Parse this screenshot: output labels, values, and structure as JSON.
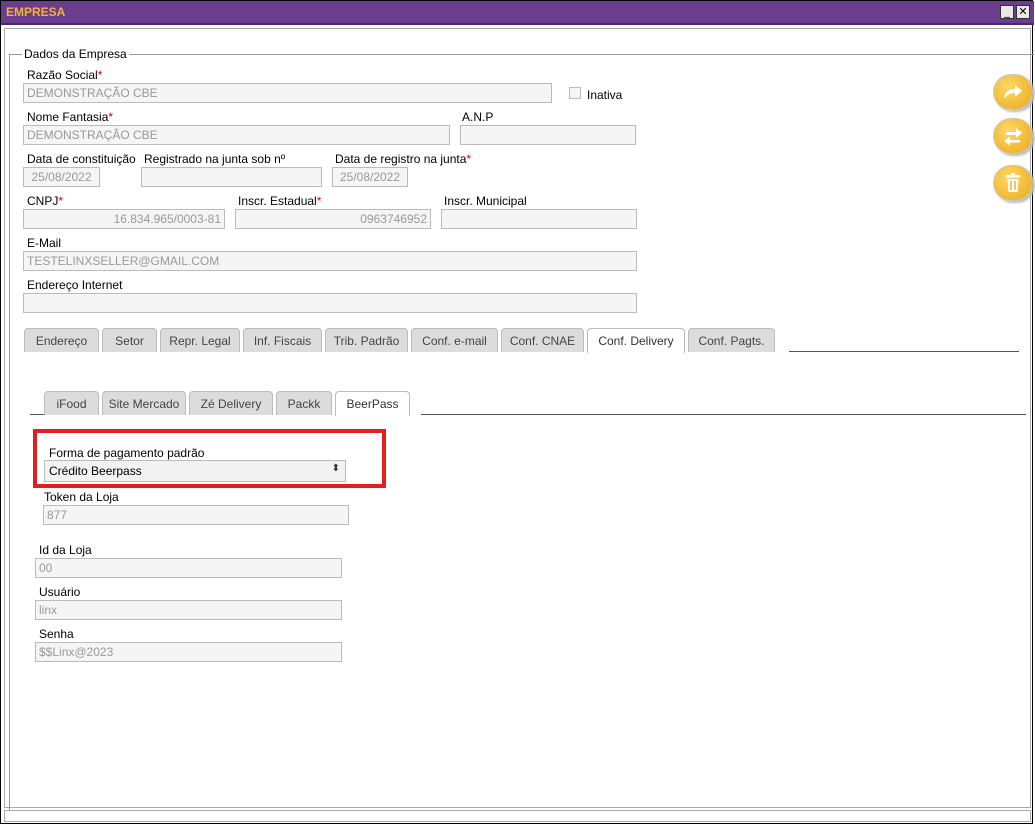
{
  "window": {
    "title": "EMPRESA",
    "minimize_label": "_",
    "close_label": "✕"
  },
  "section": {
    "legend": "Dados da Empresa"
  },
  "fields": {
    "razao_social": {
      "label": "Razão Social",
      "value": "DEMONSTRAÇÃO CBE"
    },
    "inativa": {
      "label": "Inativa"
    },
    "nome_fantasia": {
      "label": "Nome Fantasia",
      "value": "DEMONSTRAÇÃO CBE"
    },
    "anp": {
      "label": "A.N.P",
      "value": ""
    },
    "data_constituicao": {
      "label": "Data de constituição",
      "value": "25/08/2022"
    },
    "registrado_junta": {
      "label": "Registrado na junta sob nº",
      "value": ""
    },
    "data_registro_junta": {
      "label": "Data de registro na junta",
      "value": "25/08/2022"
    },
    "cnpj": {
      "label": "CNPJ",
      "value": "16.834.965/0003-81"
    },
    "inscr_estadual": {
      "label": "Inscr. Estadual",
      "value": "0963746952"
    },
    "inscr_municipal": {
      "label": "Inscr. Municipal",
      "value": ""
    },
    "email": {
      "label": "E-Mail",
      "value": "TESTELINXSELLER@GMAIL.COM"
    },
    "endereco_internet": {
      "label": "Endereço Internet",
      "value": ""
    },
    "required_mark": "*"
  },
  "main_tabs": [
    "Endereço",
    "Setor",
    "Repr. Legal",
    "Inf. Fiscais",
    "Trib. Padrão",
    "Conf. e-mail",
    "Conf. CNAE",
    "Conf. Delivery",
    "Conf. Pagts."
  ],
  "delivery_tabs": [
    "iFood",
    "Site Mercado",
    "Zé Delivery",
    "Packk",
    "BeerPass"
  ],
  "beerpass": {
    "forma_pagamento": {
      "label": "Forma de pagamento padrão",
      "value": "Crédito Beerpass"
    },
    "token": {
      "label": "Token da Loja",
      "value": "877"
    },
    "id_loja": {
      "label": "Id da Loja",
      "value": "00"
    },
    "usuario": {
      "label": "Usuário",
      "value": "linx"
    },
    "senha": {
      "label": "Senha",
      "value": "$$Linx@2023"
    }
  },
  "colors": {
    "titlebar": "#6a3d8f",
    "title_text": "#f3b13a",
    "highlight": "#e02020",
    "action_button": "#f0b830"
  },
  "icons": [
    "share-icon",
    "swap-icon",
    "trash-icon"
  ]
}
